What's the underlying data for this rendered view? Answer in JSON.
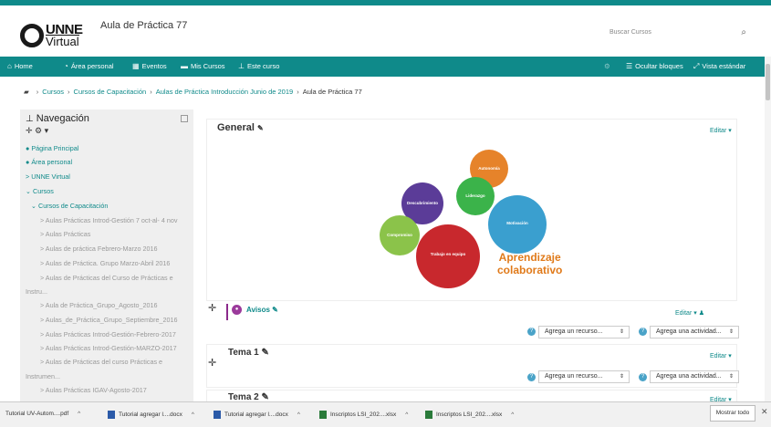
{
  "header": {
    "logo_top": "UNNE",
    "logo_bottom": "Virtual",
    "site_title": "Aula de Práctica 77",
    "search_placeholder": "Buscar Cursos"
  },
  "nav": {
    "items": [
      {
        "label": "Home",
        "icon": "home-icon"
      },
      {
        "label": "Área personal",
        "icon": "dashboard-icon"
      },
      {
        "label": "Eventos",
        "icon": "calendar-icon"
      },
      {
        "label": "Mis Cursos",
        "icon": "briefcase-icon"
      },
      {
        "label": "Este curso",
        "icon": "sitemap-icon"
      }
    ],
    "hide_blocks": "Ocultar bloques",
    "standard_view": "Vista estándar"
  },
  "breadcrumb": [
    "Cursos",
    "Cursos de Capacitación",
    "Aulas de Práctica Introducción Junio de 2019",
    "Aula de Práctica 77"
  ],
  "sidebar": {
    "title": "Navegación",
    "items": [
      {
        "label": "Página Principal",
        "style": "link",
        "indent": 0
      },
      {
        "label": "Área personal",
        "style": "link",
        "indent": 0
      },
      {
        "label": "> UNNE Virtual",
        "style": "link",
        "indent": 0
      },
      {
        "label": "⌄ Cursos",
        "style": "link",
        "indent": 0
      },
      {
        "label": "⌄ Cursos de Capacitación",
        "style": "link",
        "indent": 1
      },
      {
        "label": "> Aulas Prácticas Introd-Gestión 7 oct-al- 4 nov",
        "style": "gray",
        "indent": 2
      },
      {
        "label": "> Aulas Prácticas",
        "style": "gray",
        "indent": 2
      },
      {
        "label": "> Aulas de práctica Febrero-Marzo 2016",
        "style": "gray",
        "indent": 2
      },
      {
        "label": "> Aulas de Práctica. Grupo Marzo-Abril 2016",
        "style": "gray",
        "indent": 2
      },
      {
        "label": "> Aulas de Prácticas del Curso de Prácticas e",
        "style": "gray",
        "indent": 2
      },
      {
        "label": "Instru...",
        "style": "gray",
        "indent": 0
      },
      {
        "label": "> Aula de Práctica_Grupo_Agosto_2016",
        "style": "gray",
        "indent": 2
      },
      {
        "label": "> Aulas_de_Práctica_Grupo_Septiembre_2016",
        "style": "gray",
        "indent": 2
      },
      {
        "label": "> Aulas Prácticas Introd-Gestión-Febrero-2017",
        "style": "gray",
        "indent": 2
      },
      {
        "label": "> Aulas Prácticas Introd-Gestión-MARZO-2017",
        "style": "gray",
        "indent": 2
      },
      {
        "label": "> Aulas de Prácticas del curso Prácticas e",
        "style": "gray",
        "indent": 2
      },
      {
        "label": "Instrumen...",
        "style": "gray",
        "indent": 0
      },
      {
        "label": "> Aulas Prácticas IGAV-Agosto-2017",
        "style": "gray",
        "indent": 2
      }
    ]
  },
  "main": {
    "general_title": "General",
    "edit_label": "Editar",
    "graphic_title_line1": "Aprendizaje",
    "graphic_title_line2": "colaborativo",
    "gears": [
      "Motivación",
      "Trabajo en equipo",
      "Compromiso",
      "Descubrimiento",
      "Liderazgo",
      "Autonomía"
    ],
    "avisos_label": "Avisos",
    "add_resource": "Agrega un recurso...",
    "add_activity": "Agrega una actividad...",
    "tema1": "Tema 1",
    "tema2": "Tema 2"
  },
  "downloads": {
    "items": [
      "Tutorial UV-Autom....pdf",
      "Tutorial agregar l....docx",
      "Tutorial agregar l....docx",
      "Inscriptos LSI_202....xlsx",
      "Inscriptos LSI_202....xlsx"
    ],
    "show_all": "Mostrar todo"
  },
  "colors": {
    "accent": "#0f8a8a",
    "avisos": "#9b3a9b"
  }
}
